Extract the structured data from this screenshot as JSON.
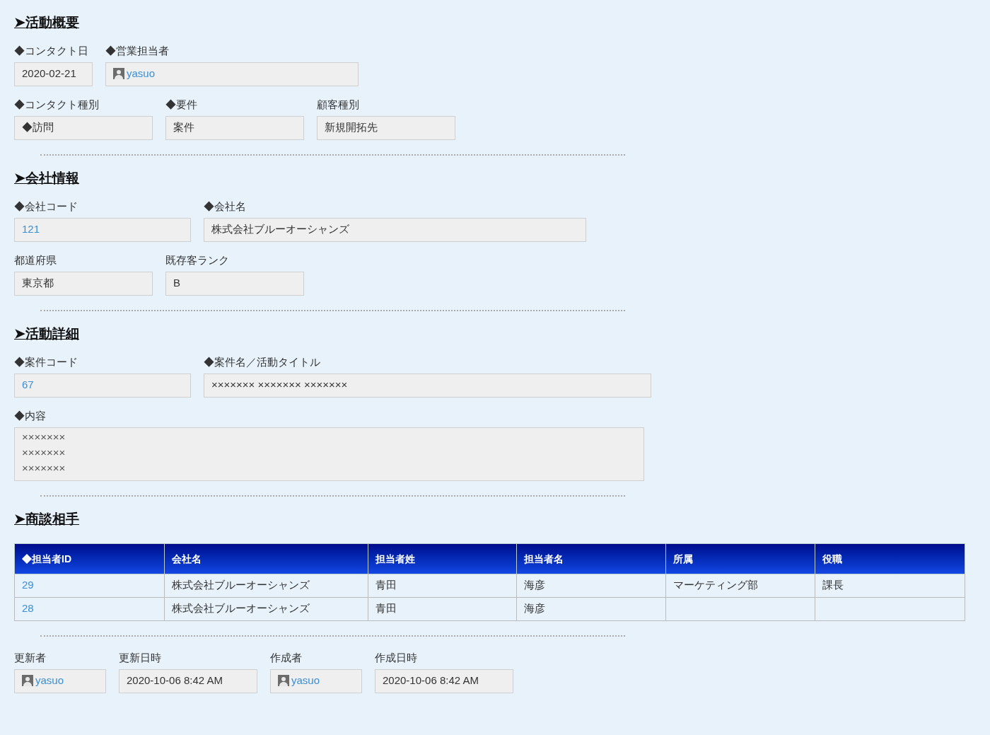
{
  "sections": [
    {
      "title": "➤活動概要",
      "rows": [
        [
          {
            "label": "◆コンタクト日",
            "kind": "text",
            "value": "2020-02-21"
          },
          {
            "label": "◆営業担当者",
            "kind": "user",
            "value": "yasuo"
          }
        ],
        [
          {
            "label": "◆コンタクト種別",
            "kind": "text",
            "value": "◆訪問"
          },
          {
            "label": "◆要件",
            "kind": "text",
            "value": "案件"
          },
          {
            "label": "顧客種別",
            "kind": "text",
            "value": "新規開拓先"
          }
        ]
      ]
    },
    {
      "title": "➤会社情報",
      "rows": [
        [
          {
            "label": "◆会社コード",
            "kind": "link",
            "value": "121"
          },
          {
            "label": "◆会社名",
            "kind": "text",
            "value": "株式会社ブルーオーシャンズ"
          }
        ],
        [
          {
            "label": "都道府県",
            "kind": "text",
            "value": "東京都"
          },
          {
            "label": "既存客ランク",
            "kind": "text",
            "value": "B"
          }
        ]
      ]
    },
    {
      "title": "➤活動詳細",
      "rows": [
        [
          {
            "label": "◆案件コード",
            "kind": "link",
            "value": "67"
          },
          {
            "label": "◆案件名／活動タイトル",
            "kind": "text",
            "value": "××××××× ××××××× ×××××××"
          }
        ],
        [
          {
            "label": "◆内容",
            "kind": "multiline",
            "lines": [
              "×××××××",
              "×××××××",
              "×××××××"
            ]
          }
        ]
      ]
    }
  ],
  "contacts": {
    "title": "➤商談相手",
    "columns": [
      "◆担当者ID",
      "会社名",
      "担当者姓",
      "担当者名",
      "所属",
      "役職"
    ],
    "rows": [
      [
        "29",
        "株式会社ブルーオーシャンズ",
        "青田",
        "海彦",
        "マーケティング部",
        "課長"
      ],
      [
        "28",
        "株式会社ブルーオーシャンズ",
        "青田",
        "海彦",
        "",
        ""
      ]
    ]
  },
  "footer": [
    {
      "label": "更新者",
      "kind": "user",
      "value": "yasuo"
    },
    {
      "label": "更新日時",
      "kind": "text",
      "value": "2020-10-06 8:42 AM"
    },
    {
      "label": "作成者",
      "kind": "user",
      "value": "yasuo"
    },
    {
      "label": "作成日時",
      "kind": "text",
      "value": "2020-10-06 8:42 AM"
    }
  ]
}
